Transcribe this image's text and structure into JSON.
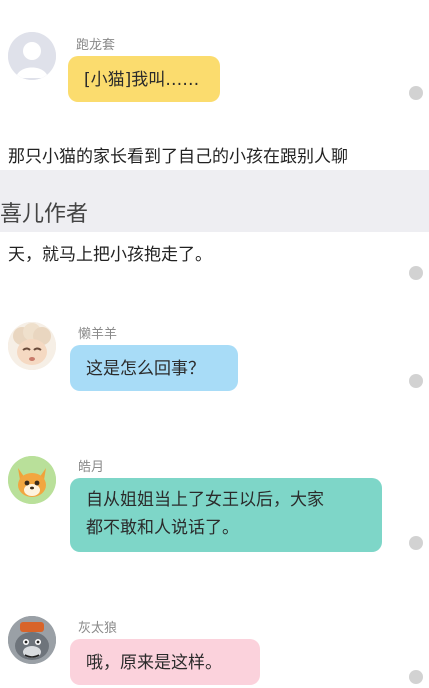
{
  "messages": [
    {
      "sender": "跑龙套",
      "text": "[小猫]我叫……",
      "bubble_color": "#fbdc6e"
    },
    {
      "sender": "懒羊羊",
      "text": "这是怎么回事？",
      "bubble_color": "#a8dcf7"
    },
    {
      "sender": "皓月",
      "text_line1": "自从姐姐当上了女王以后，大家",
      "text_line2": "都不敢和人说话了。",
      "bubble_color": "#7ed6c8"
    },
    {
      "sender": "灰太狼",
      "text": "哦，原来是这样。",
      "bubble_color": "#fbd2dc"
    }
  ],
  "narration": {
    "line1": "那只小猫的家长看到了自己的小孩在跟别人聊",
    "line2": "天，就马上把小孩抱走了。"
  },
  "watermark": "喜儿作者",
  "colors": {
    "dot": "#d2d2d2",
    "separator": "#eeeef2"
  }
}
